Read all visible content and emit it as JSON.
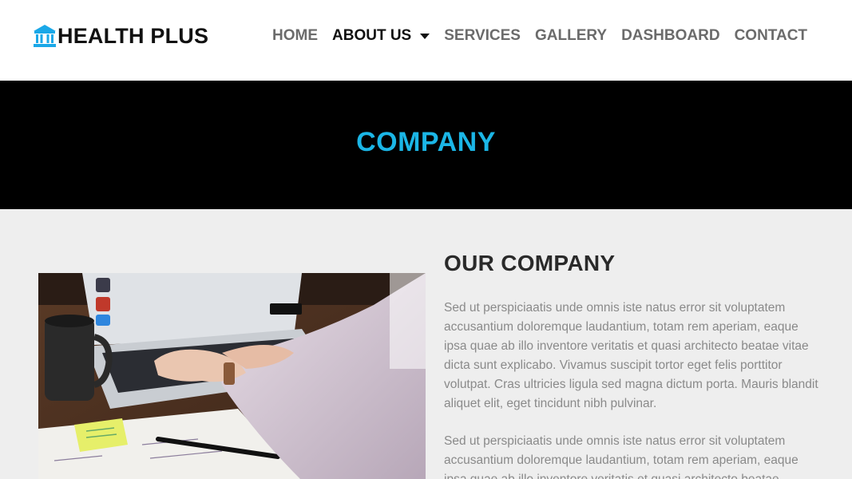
{
  "brand": {
    "name": "HEALTH PLUS",
    "icon": "bank-icon",
    "icon_color": "#1aa8e8"
  },
  "nav": {
    "items": [
      {
        "label": "HOME"
      },
      {
        "label": "ABOUT US",
        "active": true,
        "dropdown": true
      },
      {
        "label": "SERVICES"
      },
      {
        "label": "GALLERY"
      },
      {
        "label": "DASHBOARD"
      },
      {
        "label": "CONTACT"
      }
    ]
  },
  "hero": {
    "title": "COMPANY",
    "title_color": "#1bb6e6",
    "background": "#000000"
  },
  "about": {
    "title": "OUR COMPANY",
    "image": "person-typing-on-laptop-photo",
    "paragraphs": [
      "Sed ut perspiciaatis unde omnis iste natus error sit voluptatem accusantium doloremque laudantium, totam rem aperiam, eaque ipsa quae ab illo inventore veritatis et quasi architecto beatae vitae dicta sunt explicabo. Vivamus suscipit tortor eget felis porttitor volutpat. Cras ultricies ligula sed magna dictum porta. Mauris blandit aliquet elit, eget tincidunt nibh pulvinar.",
      "Sed ut perspiciaatis unde omnis iste natus error sit voluptatem accusantium doloremque laudantium, totam rem aperiam, eaque ipsa quae ab illo inventore veritatis et quasi architecto beatae"
    ]
  }
}
